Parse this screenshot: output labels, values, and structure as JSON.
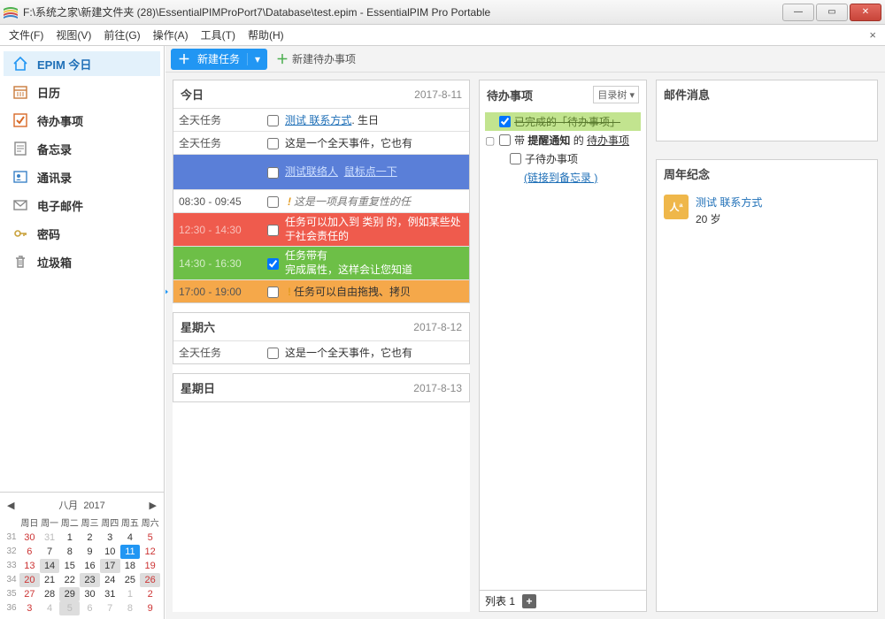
{
  "window": {
    "title": "F:\\系统之家\\新建文件夹 (28)\\EssentialPIMProPort7\\Database\\test.epim - EssentialPIM Pro Portable"
  },
  "menu": {
    "file": "文件(F)",
    "view": "视图(V)",
    "goto": "前往(G)",
    "action": "操作(A)",
    "tools": "工具(T)",
    "help": "帮助(H)"
  },
  "nav": {
    "today": "EPIM 今日",
    "calendar": "日历",
    "todo": "待办事项",
    "memo": "备忘录",
    "contacts": "通讯录",
    "mail": "电子邮件",
    "password": "密码",
    "trash": "垃圾箱"
  },
  "toolbar": {
    "new_task": "新建任务",
    "new_todo": "新建待办事项"
  },
  "today": {
    "header": "今日",
    "date": "2017-8-11",
    "allday_label": "全天任务",
    "ev_contact": "测试 联系方式",
    "ev_birthday": ". 生日",
    "ev_allday2": "这是一个全天事件，它也有",
    "blue_time": "",
    "blue_text1": "测试联络人",
    "blue_text2": "鼠标点一下",
    "rec_time": "08:30 - 09:45",
    "rec_text": "这是一项具有重复性的任",
    "red_time": "12:30 - 14:30",
    "red_text": "任务可以加入到 类别 的，例如某些处于社会责任的",
    "green_time": "14:30 - 16:30",
    "green_text1": "任务带有",
    "green_text2": "完成属性，这样会让您知道",
    "orange_time": "17:00 - 19:00",
    "orange_text": "任务可以自由拖拽、拷贝",
    "sat_header": "星期六",
    "sat_date": "2017-8-12",
    "sat_ev1": "这是一个全天事件，它也有",
    "sun_header": "星期日",
    "sun_date": "2017-8-13"
  },
  "todo_panel": {
    "header": "待办事项",
    "view": "目录树 ▾",
    "done_item": "已完成的「待办事项」",
    "reminder_pre": "带 ",
    "reminder_b": "提醒通知",
    "reminder_mid": " 的 ",
    "reminder_u": "待办事项",
    "child_item": "子待办事项",
    "memo_link": "(链接到备忘录 )",
    "footer": "列表 1"
  },
  "mail": {
    "header": "邮件消息"
  },
  "anniv": {
    "header": "周年纪念",
    "name": "测试 联系方式",
    "age": "20 岁"
  },
  "cal": {
    "month": "八月",
    "year": "2017",
    "wh": [
      "周日",
      "周一",
      "周二",
      "周三",
      "周四",
      "周五",
      "周六"
    ]
  }
}
